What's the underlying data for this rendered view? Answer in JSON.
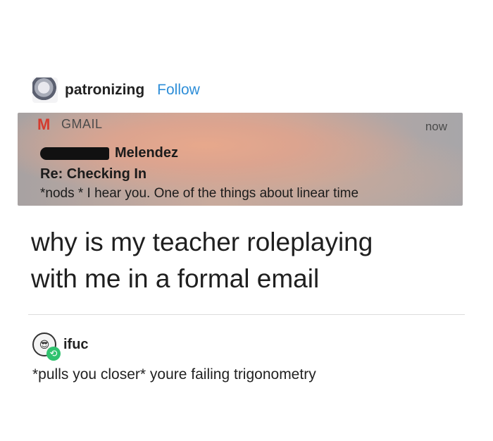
{
  "post": {
    "author": "patronizing",
    "follow_label": "Follow"
  },
  "notification": {
    "app_name": "GMAIL",
    "time": "now",
    "sender": "Melendez",
    "subject": "Re: Checking In",
    "preview": "*nods * I hear you. One of the things about linear time"
  },
  "caption": {
    "line1": "why is my teacher roleplaying",
    "line2": "with me in a formal email"
  },
  "reblog": {
    "author": "ifuc",
    "text": "*pulls you closer* youre failing trigonometry"
  },
  "colors": {
    "follow_link": "#2e8ed8",
    "gmail_red": "#d43b2f",
    "reblog_badge": "#2fc26e"
  },
  "icons": {
    "gmail": "gmail-logo-icon",
    "avatar": "user-avatar-icon",
    "reblog": "reblog-icon"
  }
}
